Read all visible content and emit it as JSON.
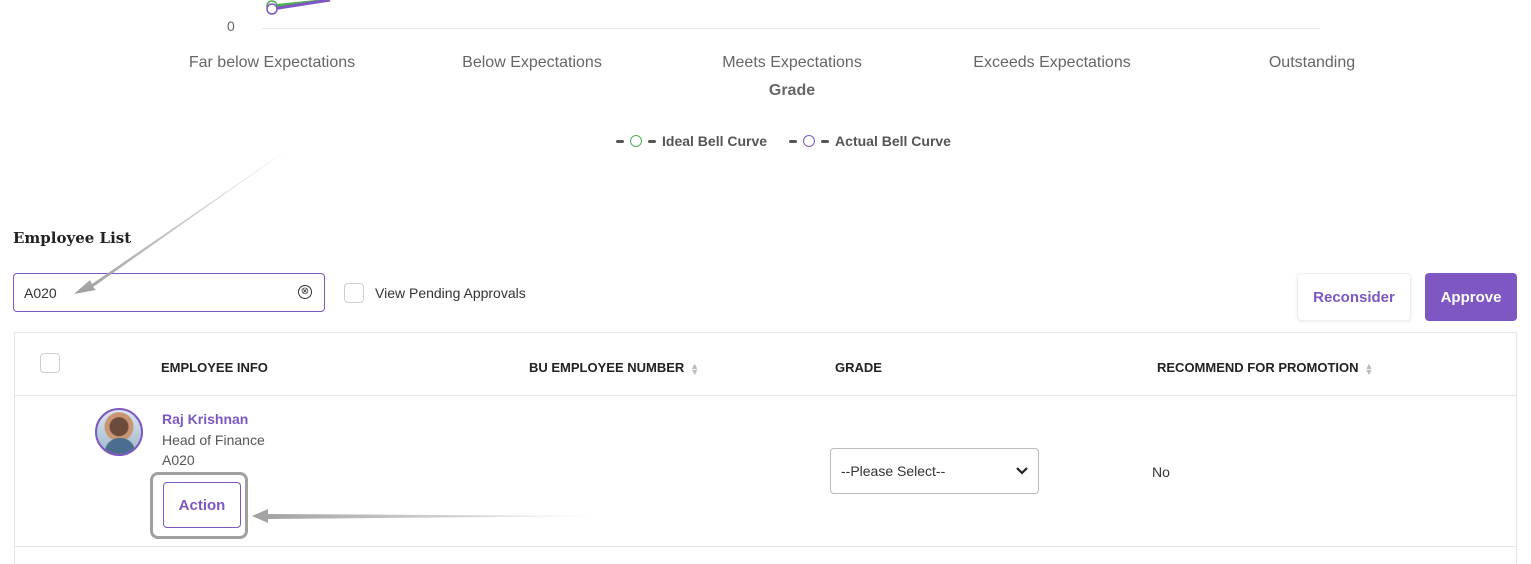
{
  "chart": {
    "y_zero_label": "0",
    "x_ticks": [
      "Far below Expectations",
      "Below Expectations",
      "Meets Expectations",
      "Exceeds Expectations",
      "Outstanding"
    ],
    "x_title": "Grade",
    "legend": [
      {
        "label": "Ideal Bell Curve",
        "color": "#4caf50"
      },
      {
        "label": "Actual Bell Curve",
        "color": "#7e57c2"
      }
    ]
  },
  "section": {
    "title": "Employee List"
  },
  "search": {
    "value": "A020",
    "clear_icon": "⊗"
  },
  "filters": {
    "pending_label": "View Pending Approvals"
  },
  "actions": {
    "reconsider_label": "Reconsider",
    "approve_label": "Approve"
  },
  "table": {
    "columns": {
      "employee_info": "EMPLOYEE INFO",
      "bu_number": "BU EMPLOYEE NUMBER",
      "grade": "GRADE",
      "promotion": "RECOMMEND FOR PROMOTION"
    },
    "rows": [
      {
        "name": "Raj Krishnan",
        "title": "Head of Finance",
        "id": "A020",
        "action_label": "Action",
        "grade_select": "--Please Select--",
        "promotion": "No"
      }
    ]
  },
  "colors": {
    "accent": "#7e57c2",
    "ideal": "#4caf50",
    "annotation": "#a0a0a0"
  }
}
